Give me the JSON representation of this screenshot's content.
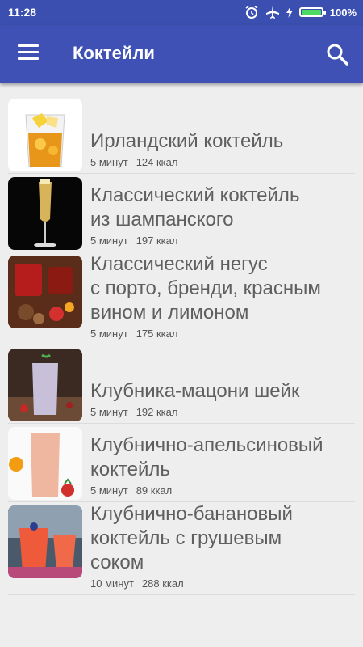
{
  "status": {
    "time": "11:28",
    "battery": "100%"
  },
  "appbar": {
    "title": "Коктейли"
  },
  "icons": {
    "menu": "menu-icon",
    "search": "search-icon",
    "alarm": "alarm-icon",
    "airplane": "airplane-icon",
    "charging": "charging-icon"
  },
  "colors": {
    "appbar": "#3f51b5",
    "statusbar": "#3a4fb0",
    "background": "#eeeeee"
  },
  "items": [
    {
      "name": "Ирландский коктейль",
      "time": "5 минут",
      "kcal": "124 ккал"
    },
    {
      "name": "Классический коктейль\nиз шампанского",
      "time": "5 минут",
      "kcal": "197 ккал"
    },
    {
      "name": "Классический негус\nс порто, бренди, красным\nвином и лимоном",
      "time": "5 минут",
      "kcal": "175 ккал"
    },
    {
      "name": "Клубника-мацони шейк",
      "time": "5 минут",
      "kcal": "192 ккал"
    },
    {
      "name": "Клубнично-апельсиновый\nкоктейль",
      "time": "5 минут",
      "kcal": "89 ккал"
    },
    {
      "name": "Клубнично-банановый\nкоктейль с грушевым\nсоком",
      "time": "10 минут",
      "kcal": "288 ккал"
    }
  ]
}
